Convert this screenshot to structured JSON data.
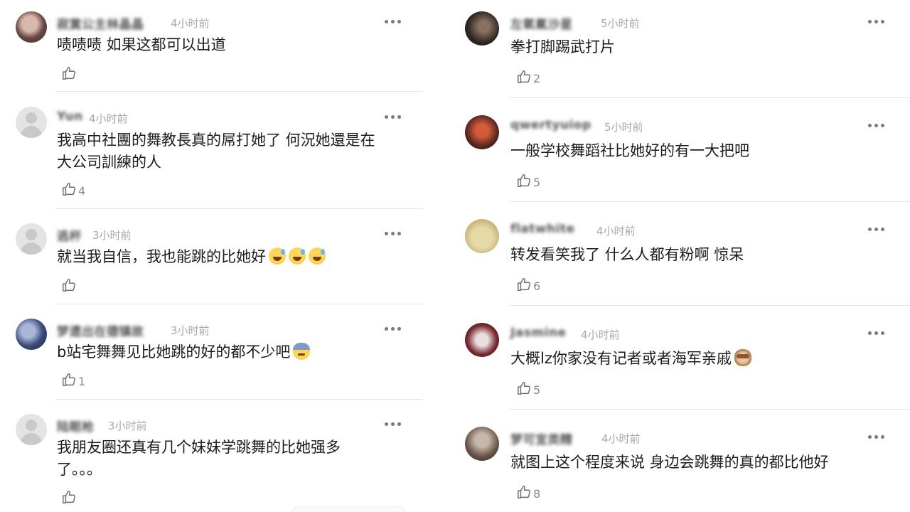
{
  "left_column": {
    "comments": [
      {
        "username": "寂寞公主林晶晶",
        "time": "4小时前",
        "body_lines": [
          "啧啧啧 如果这都可以出道"
        ],
        "likes": ""
      },
      {
        "username": "Yun",
        "time": "4小时前",
        "body_lines": [
          "我高中社團的舞教長真的屌打她了 何況她還是在",
          "大公司訓練的人"
        ],
        "likes": "4"
      },
      {
        "username": "逃杯",
        "time": "3小时前",
        "body_lines": [
          "就当我自信，我也能跳的比她好"
        ],
        "likes": ""
      },
      {
        "username": "梦遗出在德镇故",
        "time": "3小时前",
        "body_lines": [
          "b站宅舞舞见比她跳的好的都不少吧"
        ],
        "likes": "1"
      },
      {
        "username": "陆眠枪",
        "time": "3小时前",
        "body_lines": [
          "我朋友圈还真有几个妹妹学跳舞的比她强多",
          "了。。。"
        ],
        "likes": ""
      }
    ]
  },
  "right_column": {
    "comments": [
      {
        "username": "左氧氟沙星",
        "time": "5小时前",
        "body_lines": [
          "拳打脚踢武打片"
        ],
        "likes": "2"
      },
      {
        "username": "qwertyuiop",
        "time": "5小时前",
        "body_lines": [
          "一般学校舞蹈社比她好的有一大把吧"
        ],
        "likes": "5"
      },
      {
        "username": "flatwhite",
        "time": "4小时前",
        "body_lines": [
          "转发看笑我了 什么人都有粉啊 惊呆"
        ],
        "likes": "6"
      },
      {
        "username": "Jasmine",
        "time": "4小时前",
        "body_lines": [
          "大概lz你家没有记者或者海军亲戚"
        ],
        "likes": "5"
      },
      {
        "username": "梦可宜类精",
        "time": "4小时前",
        "body_lines": [
          "就图上这个程度来说 身边会跳舞的真的都比他好"
        ],
        "likes": "8"
      }
    ]
  },
  "icons": {
    "like": "thumbs-up-icon",
    "more": "more-horizontal-icon"
  },
  "colors": {
    "text": "#1c1c1c",
    "meta": "#a8a8a8",
    "divider": "#e6e6e6"
  }
}
